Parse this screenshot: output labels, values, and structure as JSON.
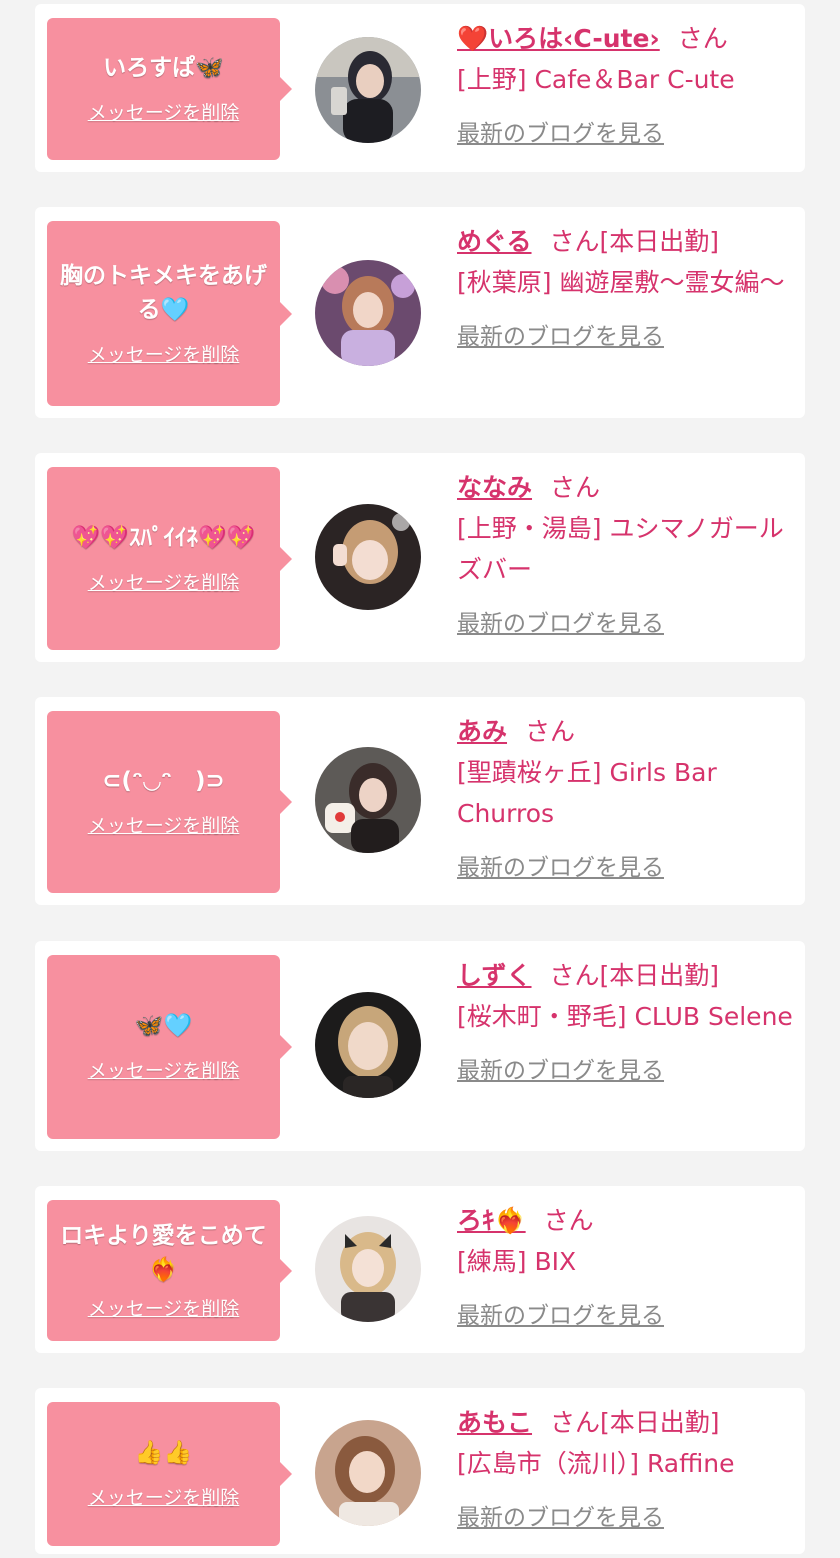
{
  "cards": [
    {
      "message": "いろすぱ🦋",
      "delete_label": "メッセージを削除",
      "name": "❤️いろは‹C-ute›",
      "san": "さん",
      "status": "",
      "shop": "[上野] Cafe＆Bar C-ute",
      "blog_label": "最新のブログを見る"
    },
    {
      "message": "胸のトキメキをあげる🩵",
      "delete_label": "メッセージを削除",
      "name": "めぐる",
      "san": "さん",
      "status": "[本日出勤]",
      "shop": "[秋葉原] 幽遊屋敷～霊女編～",
      "blog_label": "最新のブログを見る"
    },
    {
      "message": "💖💖ｽﾊﾟｲｲﾈ💖💖",
      "delete_label": "メッセージを削除",
      "name": "ななみ",
      "san": "さん",
      "status": "",
      "shop": "[上野・湯島] ユシマノガールズバー",
      "blog_label": "最新のブログを見る"
    },
    {
      "message": "⊂(ᵔ◡ᵔ　)⊃",
      "delete_label": "メッセージを削除",
      "name": "あみ",
      "san": "さん",
      "status": "",
      "shop": "[聖蹟桜ヶ丘] Girls Bar Churros",
      "blog_label": "最新のブログを見る"
    },
    {
      "message": "🦋🩵",
      "delete_label": "メッセージを削除",
      "name": "しずく",
      "san": "さん",
      "status": "[本日出勤]",
      "shop": "[桜木町・野毛] CLUB Selene",
      "blog_label": "最新のブログを見る"
    },
    {
      "message": "ロキより愛をこめて❤️‍🔥",
      "delete_label": "メッセージを削除",
      "name": "ろｷ❤️‍🔥",
      "san": "さん",
      "status": "",
      "shop": "[練馬] BIX",
      "blog_label": "最新のブログを見る"
    },
    {
      "message": "👍👍",
      "delete_label": "メッセージを削除",
      "name": "あもこ",
      "san": "さん",
      "status": "[本日出勤]",
      "shop": "[広島市（流川）] Raffine",
      "blog_label": "最新のブログを見る"
    }
  ],
  "colors": {
    "background": "#f3f3f3",
    "card": "#ffffff",
    "bubble": "#f7909f",
    "accent": "#d6336c",
    "link_gray": "#8a8a8a"
  }
}
